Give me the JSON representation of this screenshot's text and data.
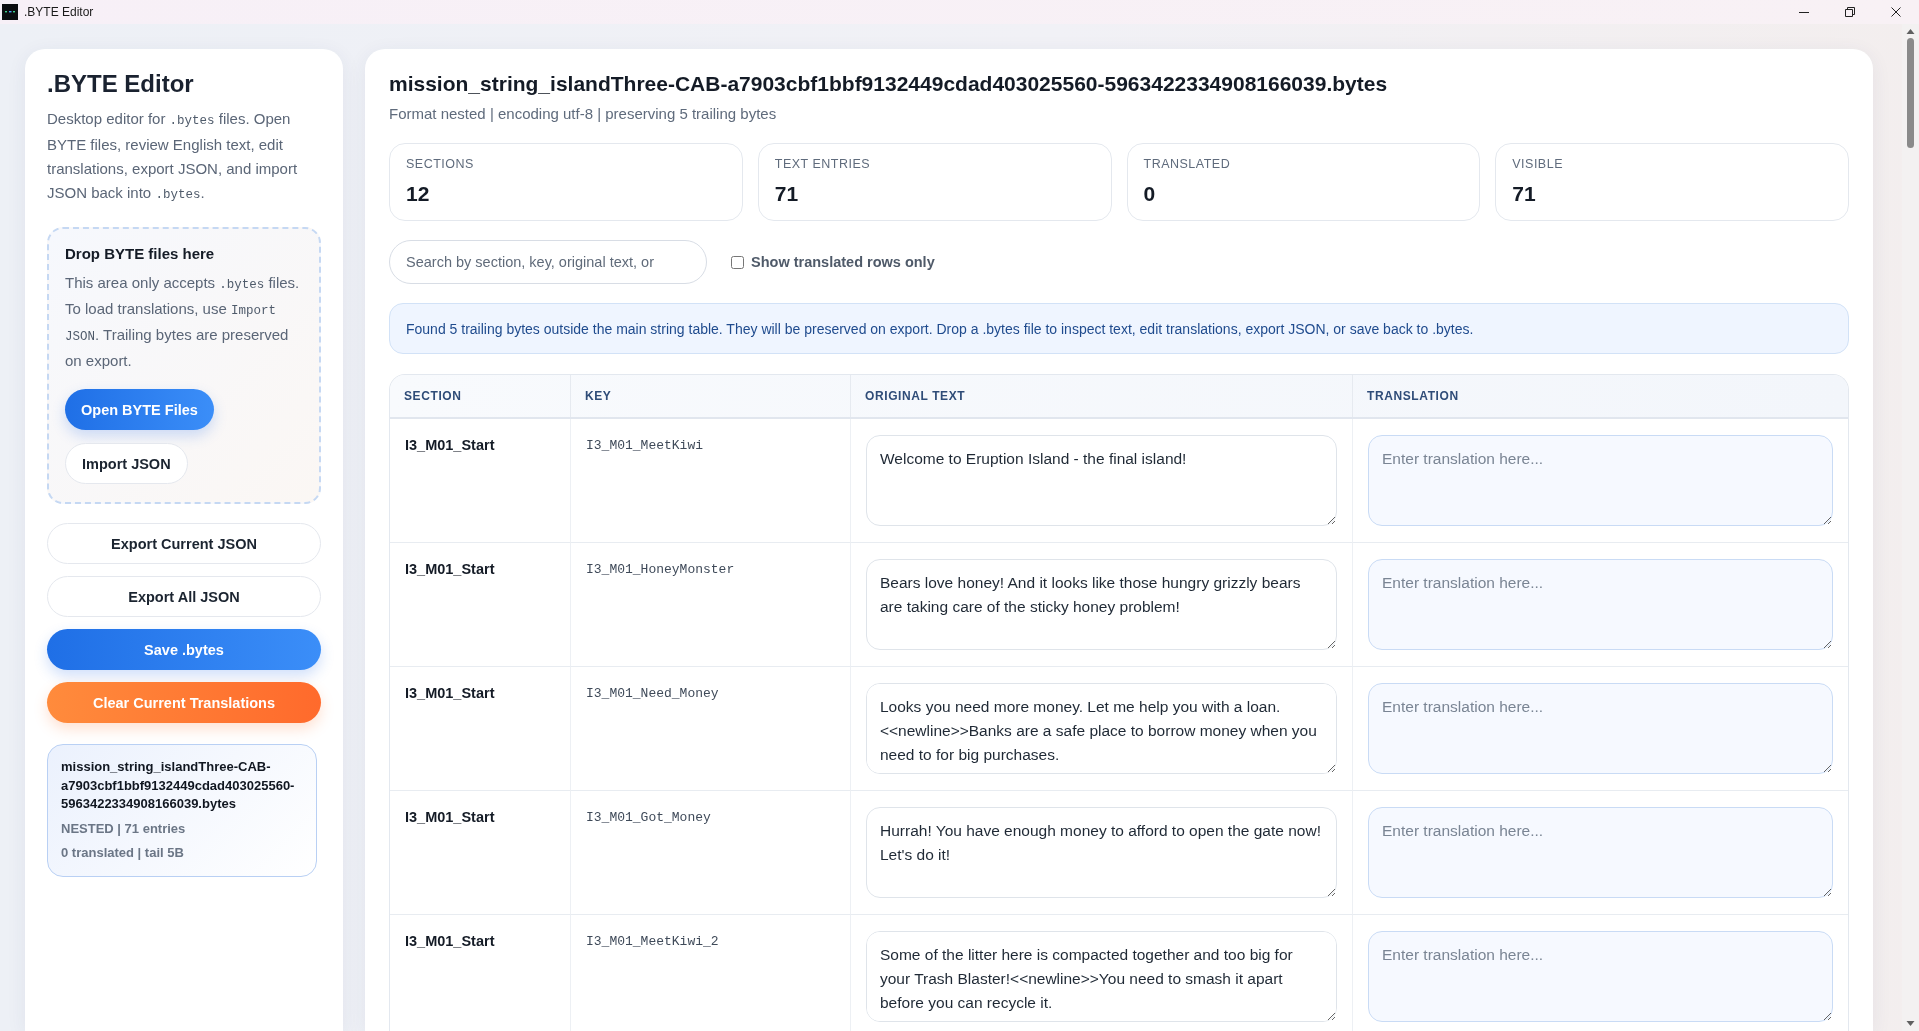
{
  "window": {
    "title": ".BYTE Editor"
  },
  "sidebar": {
    "title": ".BYTE Editor",
    "description": [
      {
        "kind": "text",
        "text": "Desktop editor for "
      },
      {
        "kind": "code",
        "text": ".bytes"
      },
      {
        "kind": "text",
        "text": " files. Open BYTE files, review English text, edit translations, export JSON, and import JSON back into "
      },
      {
        "kind": "code",
        "text": ".bytes"
      },
      {
        "kind": "text",
        "text": "."
      }
    ],
    "drop_zone": {
      "title": "Drop BYTE files here",
      "text": [
        {
          "kind": "text",
          "text": "This area only accepts "
        },
        {
          "kind": "code",
          "text": ".bytes"
        },
        {
          "kind": "text",
          "text": " files. To load translations, use "
        },
        {
          "kind": "code",
          "text": "Import JSON"
        },
        {
          "kind": "text",
          "text": ". Trailing bytes are preserved on export."
        }
      ],
      "buttons": [
        {
          "label": "Open BYTE Files",
          "kind": "primary"
        },
        {
          "label": "Import JSON",
          "kind": "secondary"
        }
      ]
    },
    "actions": [
      {
        "label": "Export Current JSON",
        "kind": "secondary"
      },
      {
        "label": "Export All JSON",
        "kind": "secondary"
      },
      {
        "label": "Save .bytes",
        "kind": "primary"
      },
      {
        "label": "Clear Current Translations",
        "kind": "danger"
      }
    ],
    "files": [
      {
        "name": "mission_string_islandThree-CAB-a7903cbf1bbf9132449cdad403025560-5963422334908166039.bytes",
        "meta": "NESTED | 71 entries",
        "status": "0 translated | tail 5B",
        "selected": true
      }
    ]
  },
  "main": {
    "title": "mission_string_islandThree-CAB-a7903cbf1bbf9132449cdad403025560-5963422334908166039.bytes",
    "subtitle": "Format nested | encoding utf-8 | preserving 5 trailing bytes",
    "stats": [
      {
        "label": "SECTIONS",
        "value": "12"
      },
      {
        "label": "TEXT ENTRIES",
        "value": "71"
      },
      {
        "label": "TRANSLATED",
        "value": "0"
      },
      {
        "label": "VISIBLE",
        "value": "71"
      }
    ],
    "search": {
      "placeholder": "Search by section, key, original text, or"
    },
    "filter": {
      "label": "Show translated rows only",
      "checked": false
    },
    "notice": "Found 5 trailing bytes outside the main string table. They will be preserved on export. Drop a .bytes file to inspect text, edit translations, export JSON, or save back to .bytes.",
    "table": {
      "columns": [
        "SECTION",
        "KEY",
        "ORIGINAL TEXT",
        "TRANSLATION"
      ],
      "rows": [
        {
          "section": "I3_M01_Start",
          "key": "I3_M01_MeetKiwi",
          "original": "Welcome to Eruption Island - the final island!",
          "translation": {
            "placeholder": "Enter translation here..."
          }
        },
        {
          "section": "I3_M01_Start",
          "key": "I3_M01_HoneyMonster",
          "original": "Bears love honey! And it looks like those hungry grizzly bears are taking care of the sticky honey problem!",
          "translation": {
            "placeholder": "Enter translation here..."
          }
        },
        {
          "section": "I3_M01_Start",
          "key": "I3_M01_Need_Money",
          "original": "Looks you need more money. Let me help you with a loan.<<newline>>Banks are a safe place to borrow money when you need to for big purchases.",
          "translation": {
            "placeholder": "Enter translation here..."
          }
        },
        {
          "section": "I3_M01_Start",
          "key": "I3_M01_Got_Money",
          "original": "Hurrah! You have enough money to afford to open the gate now! Let's do it!",
          "translation": {
            "placeholder": "Enter translation here..."
          }
        },
        {
          "section": "I3_M01_Start",
          "key": "I3_M01_MeetKiwi_2",
          "original": "Some of the litter here is compacted together and too big for your Trash Blaster!<<newline>>You need to smash it apart before you can recycle it.",
          "translation": {
            "placeholder": "Enter translation here..."
          }
        }
      ]
    }
  }
}
